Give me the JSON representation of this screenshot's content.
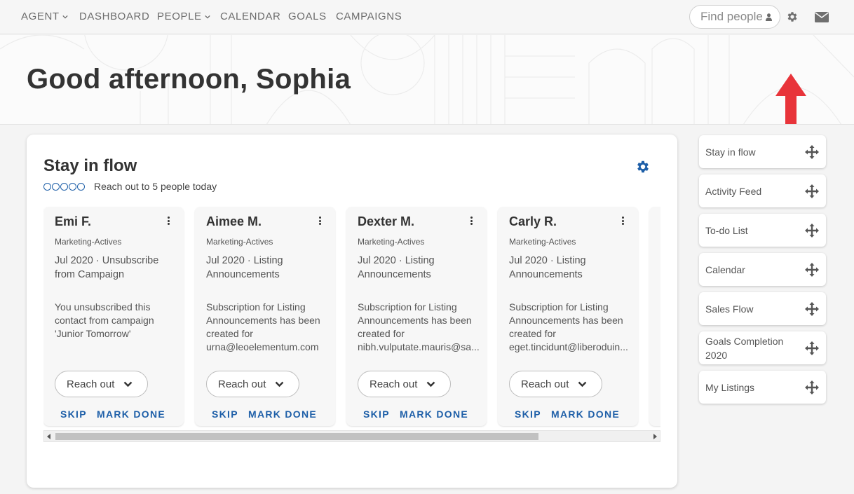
{
  "nav": {
    "items": [
      {
        "label": "AGENT",
        "dropdown": true
      },
      {
        "label": "DASHBOARD",
        "dropdown": false
      },
      {
        "label": "PEOPLE",
        "dropdown": true
      },
      {
        "label": "CALENDAR",
        "dropdown": false
      },
      {
        "label": "GOALS",
        "dropdown": false
      },
      {
        "label": "CAMPAIGNS",
        "dropdown": false
      }
    ],
    "search_placeholder": "Find people",
    "icons": [
      "person-icon",
      "gear-icon",
      "envelope-icon"
    ]
  },
  "hero": {
    "greeting": "Good afternoon, Sophia",
    "annotation_color": "#e8343a"
  },
  "stay_in_flow": {
    "title": "Stay in flow",
    "goal_text": "Reach out to 5 people today",
    "progress": {
      "done": 0,
      "total": 5
    },
    "accent": "#1e5fa8",
    "people": [
      {
        "name": "Emi F.",
        "tag": "Marketing-Actives",
        "event": "Jul 2020 · Unsubscribe from Campaign",
        "description": [
          "You unsubscribed this",
          "contact from campaign",
          "'Junior Tomorrow'"
        ],
        "reach_out": "Reach out",
        "skip": "SKIP",
        "mark_done": "MARK DONE"
      },
      {
        "name": "Aimee M.",
        "tag": "Marketing-Actives",
        "event": "Jul 2020 · Listing Announcements",
        "description": [
          "Subscription for Listing",
          "Announcements has been",
          "created for",
          "urna@leoelementum.com"
        ],
        "reach_out": "Reach out",
        "skip": "SKIP",
        "mark_done": "MARK DONE"
      },
      {
        "name": "Dexter M.",
        "tag": "Marketing-Actives",
        "event": "Jul 2020 · Listing Announcements",
        "description": [
          "Subscription for Listing",
          "Announcements has been",
          "created for",
          "nibh.vulputate.mauris@sa..."
        ],
        "reach_out": "Reach out",
        "skip": "SKIP",
        "mark_done": "MARK DONE"
      },
      {
        "name": "Carly R.",
        "tag": "Marketing-Actives",
        "event": "Jul 2020 · Listing Announcements",
        "description": [
          "Subscription for Listing",
          "Announcements has been",
          "created for",
          "eget.tincidunt@liberoduin..."
        ],
        "reach_out": "Reach out",
        "skip": "SKIP",
        "mark_done": "MARK DONE"
      }
    ]
  },
  "widgets": [
    {
      "label": "Stay in flow"
    },
    {
      "label": "Activity Feed"
    },
    {
      "label": "To-do List"
    },
    {
      "label": "Calendar"
    },
    {
      "label": "Sales Flow"
    },
    {
      "label": "Goals Completion 2020"
    },
    {
      "label": "My Listings"
    }
  ]
}
